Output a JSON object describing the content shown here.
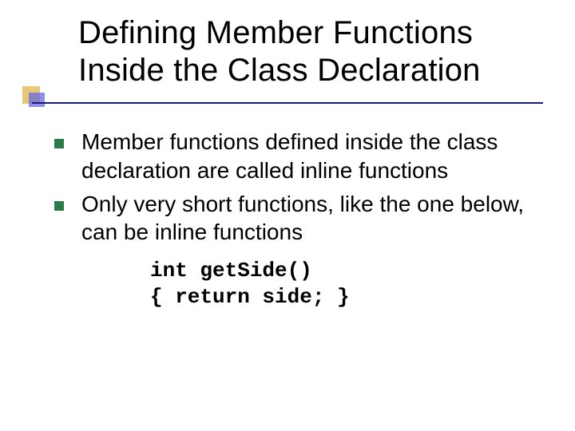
{
  "title": "Defining Member Functions Inside the Class Declaration",
  "bullets": [
    "Member functions defined inside the class declaration are called inline functions",
    "Only very short functions, like the one below, can be inline functions"
  ],
  "code": {
    "line1": "int getSide()",
    "line2": "{ return side; }"
  }
}
